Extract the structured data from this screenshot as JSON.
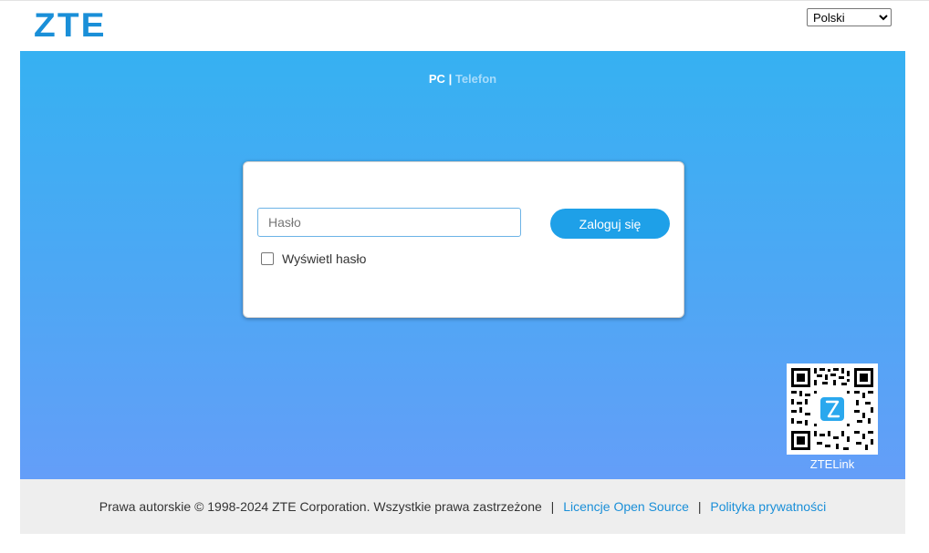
{
  "header": {
    "logo_text": "ZTE",
    "language": {
      "selected": "Polski",
      "options": [
        "Polski"
      ]
    }
  },
  "view_switch": {
    "pc_label": "PC",
    "separator": "|",
    "phone_label": "Telefon"
  },
  "login": {
    "password_placeholder": "Hasło",
    "password_value": "",
    "login_button_label": "Zaloguj się",
    "show_password_label": "Wyświetl hasło",
    "show_password_checked": false
  },
  "qr": {
    "label": "ZTELink"
  },
  "footer": {
    "copyright": "Prawa autorskie © 1998-2024 ZTE Corporation. Wszystkie prawa zastrzeżone",
    "separator": "|",
    "open_source_link": "Licencje Open Source",
    "privacy_link": "Polityka prywatności"
  },
  "colors": {
    "brand": "#1a8fd8",
    "button": "#1ea0e8",
    "gradient_top": "#36b1f2",
    "gradient_bottom": "#649ef8",
    "footer_bg": "#eeeeee"
  }
}
